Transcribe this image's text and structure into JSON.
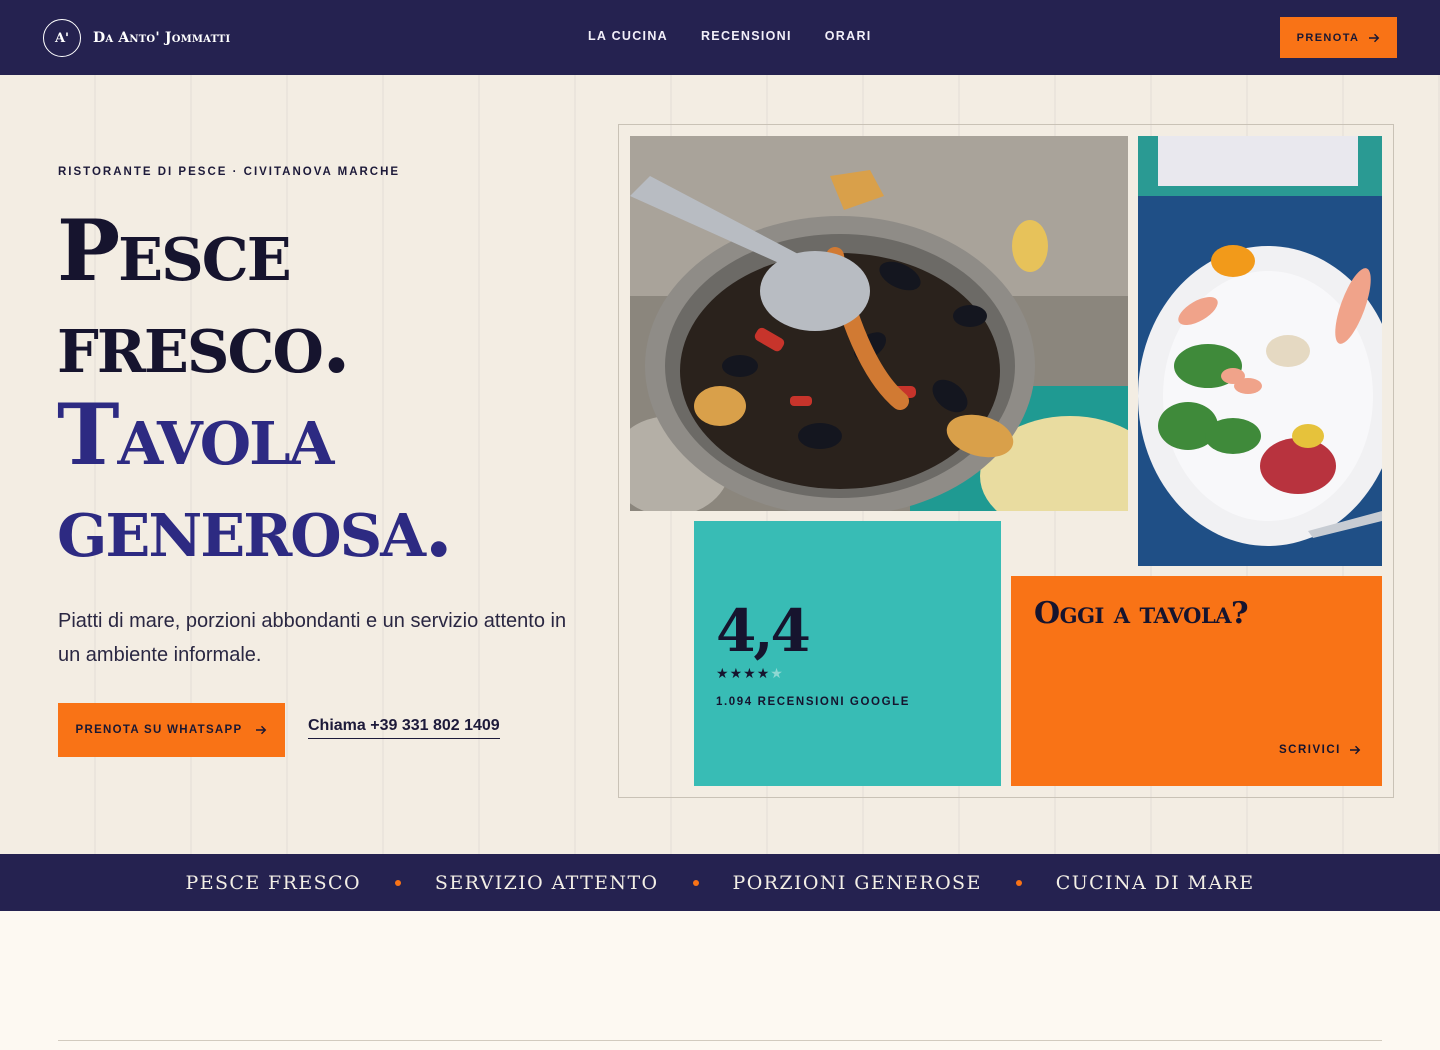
{
  "header": {
    "brand_mark": "A'",
    "brand_name": "Da Anto' Jommatti",
    "nav": [
      "LA CUCINA",
      "RECENSIONI",
      "ORARI"
    ],
    "cta_label": "PRENOTA",
    "cta_icon": "arrow-right-icon"
  },
  "hero": {
    "eyebrow": "RISTORANTE DI PESCE · CIVITANOVA MARCHE",
    "headline_lines": [
      "Pesce",
      "fresco.",
      "Tavola",
      "generosa."
    ],
    "lede": "Piatti di mare, porzioni abbondanti e un servizio attento in un ambiente informale.",
    "whatsapp_label": "PRENOTA SU WHATSAPP",
    "call_label": "Chiama +39 331 802 1409"
  },
  "mosaic": {
    "rating_value": "4,4",
    "rating_stars": 4,
    "rating_caption": "1.094 RECENSIONI GOOGLE",
    "cta_title": "Oggi a tavola?",
    "cta_link": "SCRIVICI"
  },
  "ticker": [
    "PESCE FRESCO",
    "SERVIZIO ATTENTO",
    "PORZIONI GENEROSE",
    "CUCINA DI MARE"
  ],
  "colors": {
    "navy": "#252250",
    "orange": "#f97316",
    "teal": "#38bcb5",
    "headline_blue": "#2d2a82",
    "cream": "#f3ede3"
  }
}
